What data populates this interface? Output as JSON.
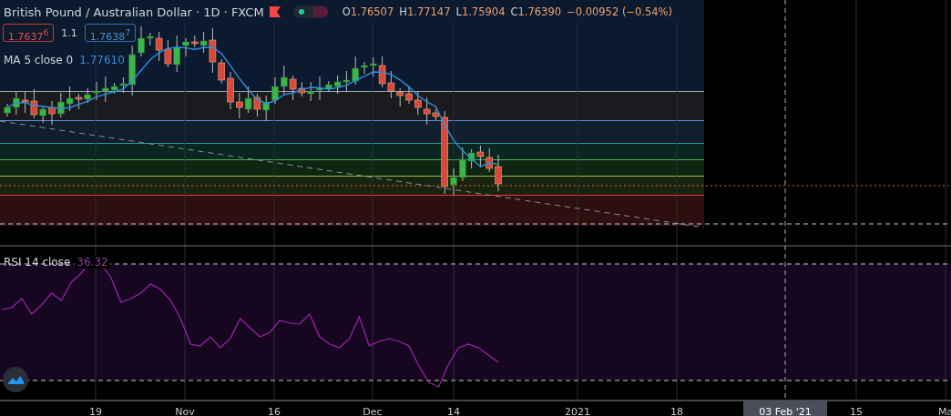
{
  "header": {
    "symbol": "British Pound / Australian Dollar · 1D · FXCM",
    "legend": [
      {
        "label": "O",
        "value": "1.76507"
      },
      {
        "label": "H",
        "value": "1.77147"
      },
      {
        "label": "L",
        "value": "1.75904"
      },
      {
        "label": "C",
        "value": "1.76390"
      },
      {
        "value": "−0.00952 (−0.54%)"
      }
    ]
  },
  "trade": {
    "sell": "1.7637$^{6}$",
    "spread": "1.1",
    "buy": "1.7638$^{7}$"
  },
  "indicators": [
    {
      "kind": "ma",
      "label": "MA 5 close 0",
      "value": "1.77610"
    },
    {
      "kind": "rsi",
      "label": "RSI 14 close",
      "value": "36.32"
    }
  ],
  "time_axis": [
    "19",
    "Nov",
    "16",
    "Dec",
    "14",
    "2021",
    "18",
    "15",
    "Ma"
  ],
  "crosshair": {
    "label": "03 Feb '21"
  }
}
